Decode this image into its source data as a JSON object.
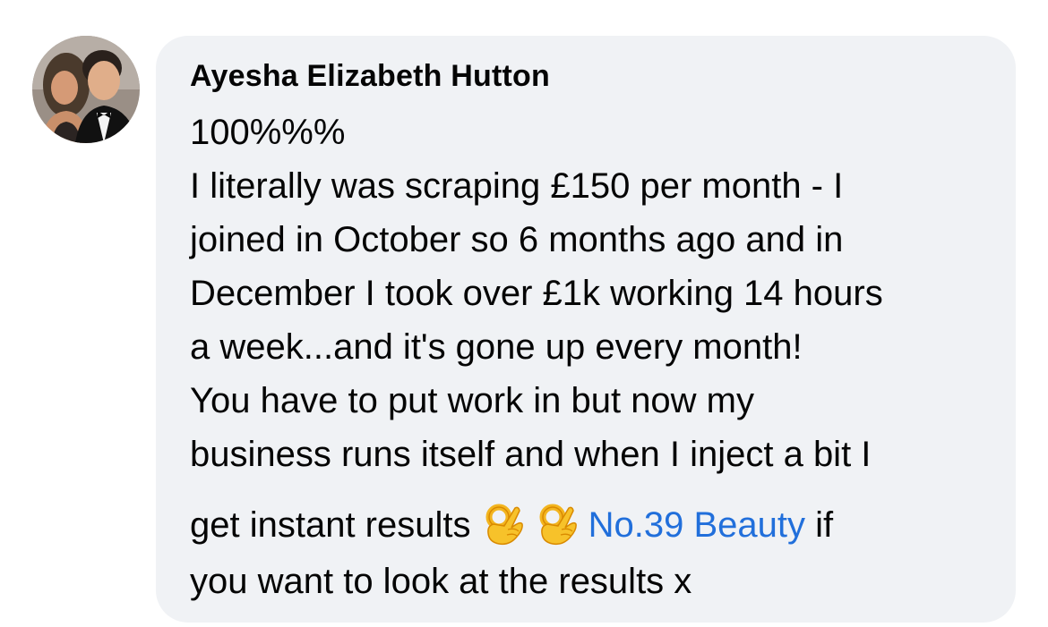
{
  "comment": {
    "author": "Ayesha Elizabeth Hutton",
    "lines": {
      "l1": "100%%%",
      "l2": "I literally was scraping £150 per month - I",
      "l3": "joined in October so 6 months ago and in",
      "l4": "December I took over £1k working 14 hours",
      "l5": "a week...and it's gone up every month!",
      "l6": "You have to put work in but now my",
      "l7": "business runs itself and when I inject a bit I",
      "l8_before": "get instant results",
      "l8_after": " if",
      "l9": "you want to look at the results x"
    },
    "emojis": [
      "ok-hand-icon",
      "ok-hand-icon"
    ],
    "mention": "No.39 Beauty"
  },
  "colors": {
    "bubble": "#f0f2f5",
    "text": "#050505",
    "mention": "#216fdb"
  }
}
